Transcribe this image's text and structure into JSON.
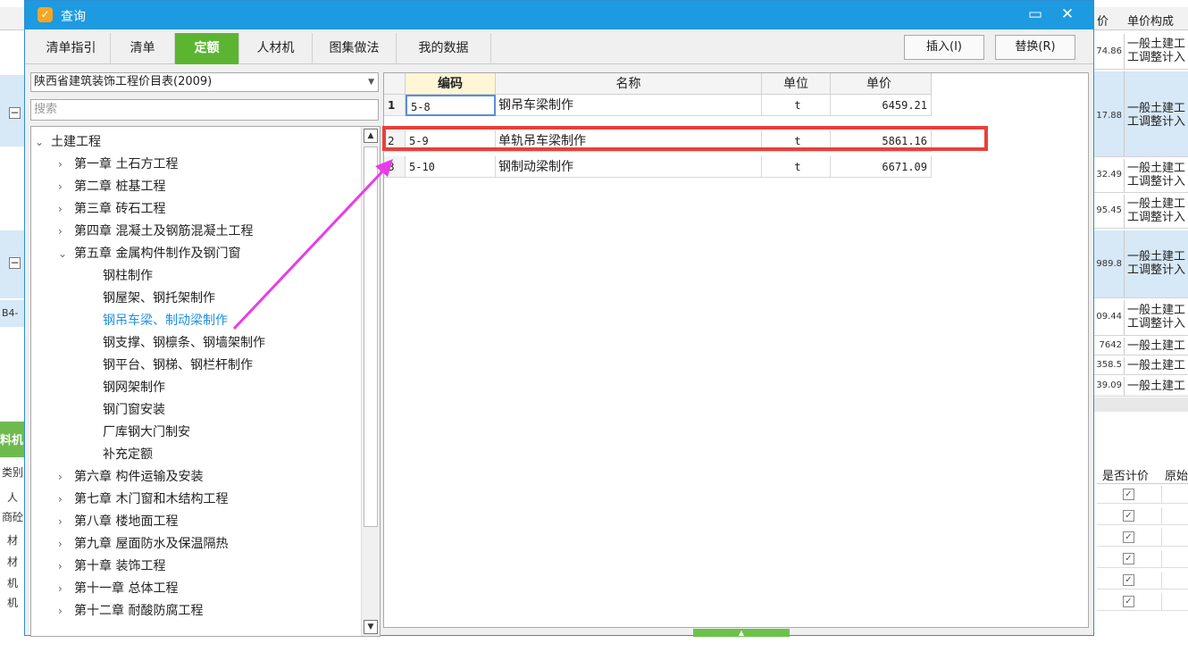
{
  "background": {
    "header": {
      "col1": "价",
      "col2": "单价构成"
    },
    "rows": [
      {
        "value": "74.86",
        "text": [
          "一般土建工",
          "工调整计入"
        ]
      },
      {
        "value": "17.88",
        "text": [
          "一般土建工",
          "工调整计入"
        ]
      },
      {
        "value": "32.49",
        "text": [
          "一般土建工",
          "工调整计入"
        ]
      },
      {
        "value": "95.45",
        "text": [
          "一般土建工",
          "工调整计入"
        ]
      },
      {
        "value": "989.8",
        "text": [
          "一般土建工",
          "工调整计入"
        ]
      },
      {
        "value": "09.44",
        "text": [
          "一般土建工",
          "工调整计入"
        ]
      },
      {
        "value": "7642",
        "text": [
          "一般土建工"
        ]
      },
      {
        "value": "358.5",
        "text": [
          "一般土建工"
        ]
      },
      {
        "value": "39.09",
        "text": [
          "一般土建工"
        ]
      }
    ],
    "lower_header": {
      "col1": "是否计价",
      "col2": "原始"
    },
    "left_labels": [
      "料机",
      "类别",
      "人",
      "商砼",
      "材",
      "材",
      "机",
      "机"
    ],
    "left_code": "B4-"
  },
  "dialog": {
    "title": "查询",
    "tabs": [
      "清单指引",
      "清单",
      "定额",
      "人材机",
      "图集做法",
      "我的数据"
    ],
    "active_tab": 2,
    "insert_button": "插入(I)",
    "replace_button": "替换(R)",
    "library": "陕西省建筑装饰工程价目表(2009)",
    "search_placeholder": "搜索"
  },
  "tree": [
    {
      "label": "土建工程",
      "level": 0,
      "expanded": true
    },
    {
      "label": "第一章 土石方工程",
      "level": 1,
      "expanded": false
    },
    {
      "label": "第二章 桩基工程",
      "level": 1,
      "expanded": false
    },
    {
      "label": "第三章 砖石工程",
      "level": 1,
      "expanded": false
    },
    {
      "label": "第四章 混凝土及钢筋混凝土工程",
      "level": 1,
      "expanded": false
    },
    {
      "label": "第五章 金属构件制作及钢门窗",
      "level": 1,
      "expanded": true
    },
    {
      "label": "钢柱制作",
      "level": 2
    },
    {
      "label": "钢屋架、钢托架制作",
      "level": 2
    },
    {
      "label": "钢吊车梁、制动梁制作",
      "level": 2,
      "selected": true
    },
    {
      "label": "钢支撑、钢檩条、钢墙架制作",
      "level": 2
    },
    {
      "label": "钢平台、钢梯、钢栏杆制作",
      "level": 2
    },
    {
      "label": "钢网架制作",
      "level": 2
    },
    {
      "label": "钢门窗安装",
      "level": 2
    },
    {
      "label": "厂库钢大门制安",
      "level": 2
    },
    {
      "label": "补充定额",
      "level": 2
    },
    {
      "label": "第六章 构件运输及安装",
      "level": 1,
      "expanded": false
    },
    {
      "label": "第七章 木门窗和木结构工程",
      "level": 1,
      "expanded": false
    },
    {
      "label": "第八章 楼地面工程",
      "level": 1,
      "expanded": false
    },
    {
      "label": "第九章 屋面防水及保温隔热",
      "level": 1,
      "expanded": false
    },
    {
      "label": "第十章 装饰工程",
      "level": 1,
      "expanded": false
    },
    {
      "label": "第十一章 总体工程",
      "level": 1,
      "expanded": false
    },
    {
      "label": "第十二章 耐酸防腐工程",
      "level": 1,
      "expanded": false
    }
  ],
  "table": {
    "columns": [
      "编码",
      "名称",
      "单位",
      "单价"
    ],
    "rows": [
      {
        "idx": "1",
        "code": "5-8",
        "name": "钢吊车梁制作",
        "unit": "t",
        "price": "6459.21"
      },
      {
        "idx": "2",
        "code": "5-9",
        "name": "单轨吊车梁制作",
        "unit": "t",
        "price": "5861.16"
      },
      {
        "idx": "3",
        "code": "5-10",
        "name": "钢制动梁制作",
        "unit": "t",
        "price": "6671.09"
      }
    ]
  },
  "colors": {
    "titlebar": "#1e9ae0",
    "active_tab": "#5cb531",
    "selected_tree_item": "#1e90e0",
    "highlight_box": "#e8413b",
    "annotation_arrow": "#e83ce8"
  }
}
